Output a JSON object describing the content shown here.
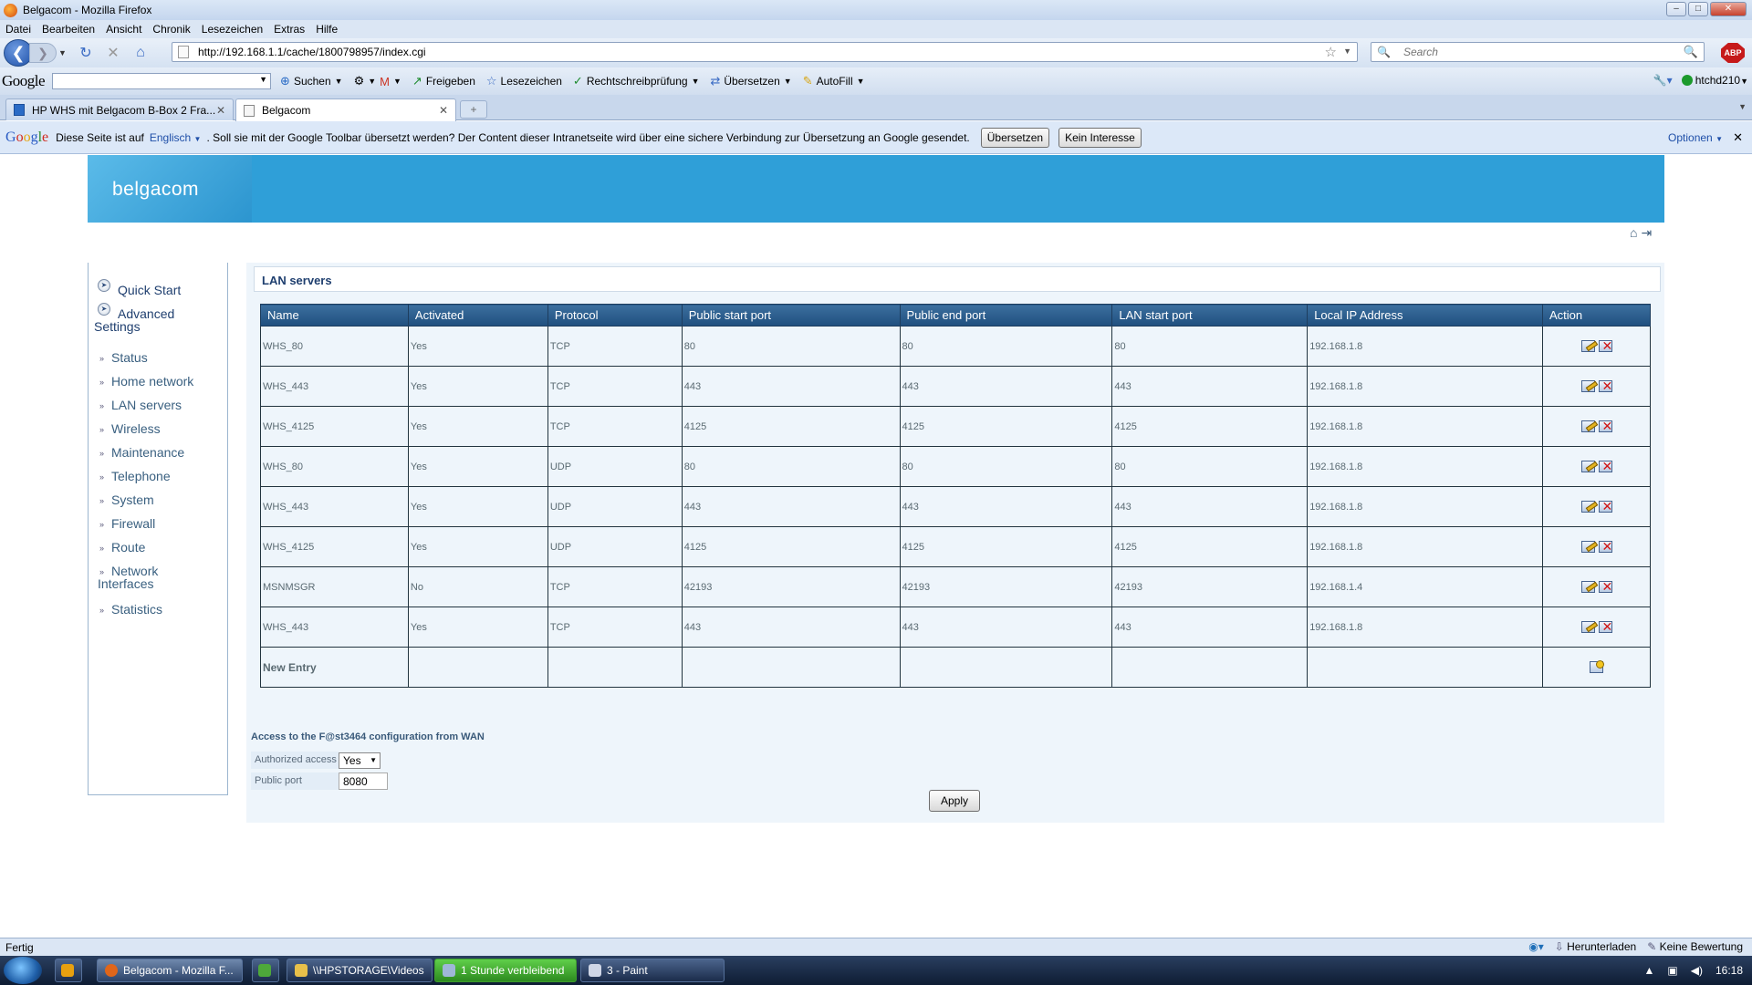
{
  "window": {
    "title": "Belgacom - Mozilla Firefox"
  },
  "menu": [
    "Datei",
    "Bearbeiten",
    "Ansicht",
    "Chronik",
    "Lesezeichen",
    "Extras",
    "Hilfe"
  ],
  "nav": {
    "url": "http://192.168.1.1/cache/1800798957/index.cgi",
    "search_placeholder": "Search",
    "abp": "ABP"
  },
  "google_toolbar": {
    "logo": "Google",
    "items": [
      "Suchen",
      "Freigeben",
      "Lesezeichen",
      "Rechtschreibprüfung",
      "Übersetzen",
      "AutoFill"
    ],
    "user": "htchd210"
  },
  "tabs": [
    {
      "label": "HP WHS mit Belgacom B-Box 2 Fra...",
      "active": false
    },
    {
      "label": "Belgacom",
      "active": true
    }
  ],
  "translate_bar": {
    "logo": "Google",
    "prefix": "Diese Seite ist auf",
    "language": "Englisch",
    "message": ". Soll sie mit der Google Toolbar übersetzt werden? Der Content dieser Intranetseite wird über eine sichere Verbindung zur Übersetzung an Google gesendet.",
    "translate_btn": "Übersetzen",
    "no_interest_btn": "Kein Interesse",
    "options": "Optionen"
  },
  "page": {
    "brand": "belgacom",
    "sidebar": {
      "quick_start": "Quick Start",
      "advanced_settings_line1": "Advanced",
      "advanced_settings_line2": "Settings",
      "items": [
        "Status",
        "Home network",
        "LAN servers",
        "Wireless",
        "Maintenance",
        "Telephone",
        "System",
        "Firewall",
        "Route",
        "Network",
        "Statistics"
      ],
      "network_interfaces_line2": "Interfaces"
    },
    "section_title": "LAN servers",
    "table": {
      "headers": [
        "Name",
        "Activated",
        "Protocol",
        "Public start port",
        "Public end port",
        "LAN start port",
        "Local IP Address",
        "Action"
      ],
      "rows": [
        [
          "WHS_80",
          "Yes",
          "TCP",
          "80",
          "80",
          "80",
          "192.168.1.8"
        ],
        [
          "WHS_443",
          "Yes",
          "TCP",
          "443",
          "443",
          "443",
          "192.168.1.8"
        ],
        [
          "WHS_4125",
          "Yes",
          "TCP",
          "4125",
          "4125",
          "4125",
          "192.168.1.8"
        ],
        [
          "WHS_80",
          "Yes",
          "UDP",
          "80",
          "80",
          "80",
          "192.168.1.8"
        ],
        [
          "WHS_443",
          "Yes",
          "UDP",
          "443",
          "443",
          "443",
          "192.168.1.8"
        ],
        [
          "WHS_4125",
          "Yes",
          "UDP",
          "4125",
          "4125",
          "4125",
          "192.168.1.8"
        ],
        [
          "MSNMSGR",
          "No",
          "TCP",
          "42193",
          "42193",
          "42193",
          "192.168.1.4"
        ],
        [
          "WHS_443",
          "Yes",
          "TCP",
          "443",
          "443",
          "443",
          "192.168.1.8"
        ]
      ],
      "new_entry": "New Entry"
    },
    "wan": {
      "title": "Access to the F@st3464 configuration from WAN",
      "authorized_label": "Authorized access",
      "authorized_value": "Yes",
      "port_label": "Public port",
      "port_value": "8080",
      "apply": "Apply"
    }
  },
  "statusbar": {
    "text": "Fertig",
    "download": "Herunterladen",
    "rating": "Keine Bewertung"
  },
  "taskbar": {
    "items": [
      "Belgacom - Mozilla F...",
      "\\\\HPSTORAGE\\Videos",
      "1 Stunde verbleibend",
      "3 - Paint"
    ],
    "clock": "16:18"
  }
}
